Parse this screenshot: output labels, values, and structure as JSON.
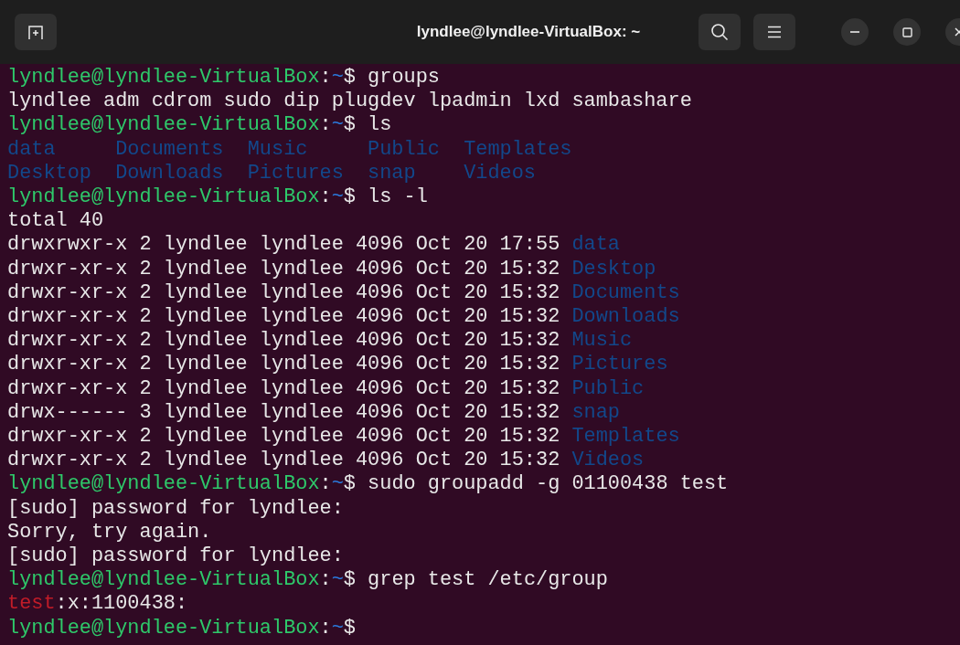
{
  "window": {
    "title": "lyndlee@lyndlee-VirtualBox: ~"
  },
  "lines": [
    {
      "segments": [
        {
          "text": "lyndlee@lyndlee-VirtualBox",
          "kind": "user"
        },
        {
          "text": ":",
          "kind": "plain"
        },
        {
          "text": "~",
          "kind": "path"
        },
        {
          "text": "$ groups",
          "kind": "plain"
        }
      ]
    },
    {
      "segments": [
        {
          "text": "lyndlee adm cdrom sudo dip plugdev lpadmin lxd sambashare",
          "kind": "plain"
        }
      ]
    },
    {
      "segments": [
        {
          "text": "lyndlee@lyndlee-VirtualBox",
          "kind": "user"
        },
        {
          "text": ":",
          "kind": "plain"
        },
        {
          "text": "~",
          "kind": "path"
        },
        {
          "text": "$ ls",
          "kind": "plain"
        }
      ]
    },
    {
      "segments": [
        {
          "text": "data     Documents  Music     Public  Templates",
          "kind": "dir"
        }
      ]
    },
    {
      "segments": [
        {
          "text": "Desktop  Downloads  Pictures  snap    Videos",
          "kind": "dir"
        }
      ]
    },
    {
      "segments": [
        {
          "text": "lyndlee@lyndlee-VirtualBox",
          "kind": "user"
        },
        {
          "text": ":",
          "kind": "plain"
        },
        {
          "text": "~",
          "kind": "path"
        },
        {
          "text": "$ ls -l",
          "kind": "plain"
        }
      ]
    },
    {
      "segments": [
        {
          "text": "total 40",
          "kind": "plain"
        }
      ]
    },
    {
      "segments": [
        {
          "text": "drwxrwxr-x 2 lyndlee lyndlee 4096 Oct 20 17:55 ",
          "kind": "plain"
        },
        {
          "text": "data",
          "kind": "dir"
        }
      ]
    },
    {
      "segments": [
        {
          "text": "drwxr-xr-x 2 lyndlee lyndlee 4096 Oct 20 15:32 ",
          "kind": "plain"
        },
        {
          "text": "Desktop",
          "kind": "dir"
        }
      ]
    },
    {
      "segments": [
        {
          "text": "drwxr-xr-x 2 lyndlee lyndlee 4096 Oct 20 15:32 ",
          "kind": "plain"
        },
        {
          "text": "Documents",
          "kind": "dir"
        }
      ]
    },
    {
      "segments": [
        {
          "text": "drwxr-xr-x 2 lyndlee lyndlee 4096 Oct 20 15:32 ",
          "kind": "plain"
        },
        {
          "text": "Downloads",
          "kind": "dir"
        }
      ]
    },
    {
      "segments": [
        {
          "text": "drwxr-xr-x 2 lyndlee lyndlee 4096 Oct 20 15:32 ",
          "kind": "plain"
        },
        {
          "text": "Music",
          "kind": "dir"
        }
      ]
    },
    {
      "segments": [
        {
          "text": "drwxr-xr-x 2 lyndlee lyndlee 4096 Oct 20 15:32 ",
          "kind": "plain"
        },
        {
          "text": "Pictures",
          "kind": "dir"
        }
      ]
    },
    {
      "segments": [
        {
          "text": "drwxr-xr-x 2 lyndlee lyndlee 4096 Oct 20 15:32 ",
          "kind": "plain"
        },
        {
          "text": "Public",
          "kind": "dir"
        }
      ]
    },
    {
      "segments": [
        {
          "text": "drwx------ 3 lyndlee lyndlee 4096 Oct 20 15:32 ",
          "kind": "plain"
        },
        {
          "text": "snap",
          "kind": "dir"
        }
      ]
    },
    {
      "segments": [
        {
          "text": "drwxr-xr-x 2 lyndlee lyndlee 4096 Oct 20 15:32 ",
          "kind": "plain"
        },
        {
          "text": "Templates",
          "kind": "dir"
        }
      ]
    },
    {
      "segments": [
        {
          "text": "drwxr-xr-x 2 lyndlee lyndlee 4096 Oct 20 15:32 ",
          "kind": "plain"
        },
        {
          "text": "Videos",
          "kind": "dir"
        }
      ]
    },
    {
      "segments": [
        {
          "text": "lyndlee@lyndlee-VirtualBox",
          "kind": "user"
        },
        {
          "text": ":",
          "kind": "plain"
        },
        {
          "text": "~",
          "kind": "path"
        },
        {
          "text": "$ sudo groupadd -g 01100438 test",
          "kind": "plain"
        }
      ]
    },
    {
      "segments": [
        {
          "text": "[sudo] password for lyndlee:",
          "kind": "plain"
        }
      ]
    },
    {
      "segments": [
        {
          "text": "Sorry, try again.",
          "kind": "plain"
        }
      ]
    },
    {
      "segments": [
        {
          "text": "[sudo] password for lyndlee:",
          "kind": "plain"
        }
      ]
    },
    {
      "segments": [
        {
          "text": "lyndlee@lyndlee-VirtualBox",
          "kind": "user"
        },
        {
          "text": ":",
          "kind": "plain"
        },
        {
          "text": "~",
          "kind": "path"
        },
        {
          "text": "$ grep test /etc/group",
          "kind": "plain"
        }
      ]
    },
    {
      "segments": [
        {
          "text": "test",
          "kind": "match"
        },
        {
          "text": ":x:1100438:",
          "kind": "plain"
        }
      ]
    },
    {
      "segments": [
        {
          "text": "lyndlee@lyndlee-VirtualBox",
          "kind": "user"
        },
        {
          "text": ":",
          "kind": "plain"
        },
        {
          "text": "~",
          "kind": "path"
        },
        {
          "text": "$",
          "kind": "plain"
        }
      ]
    }
  ]
}
